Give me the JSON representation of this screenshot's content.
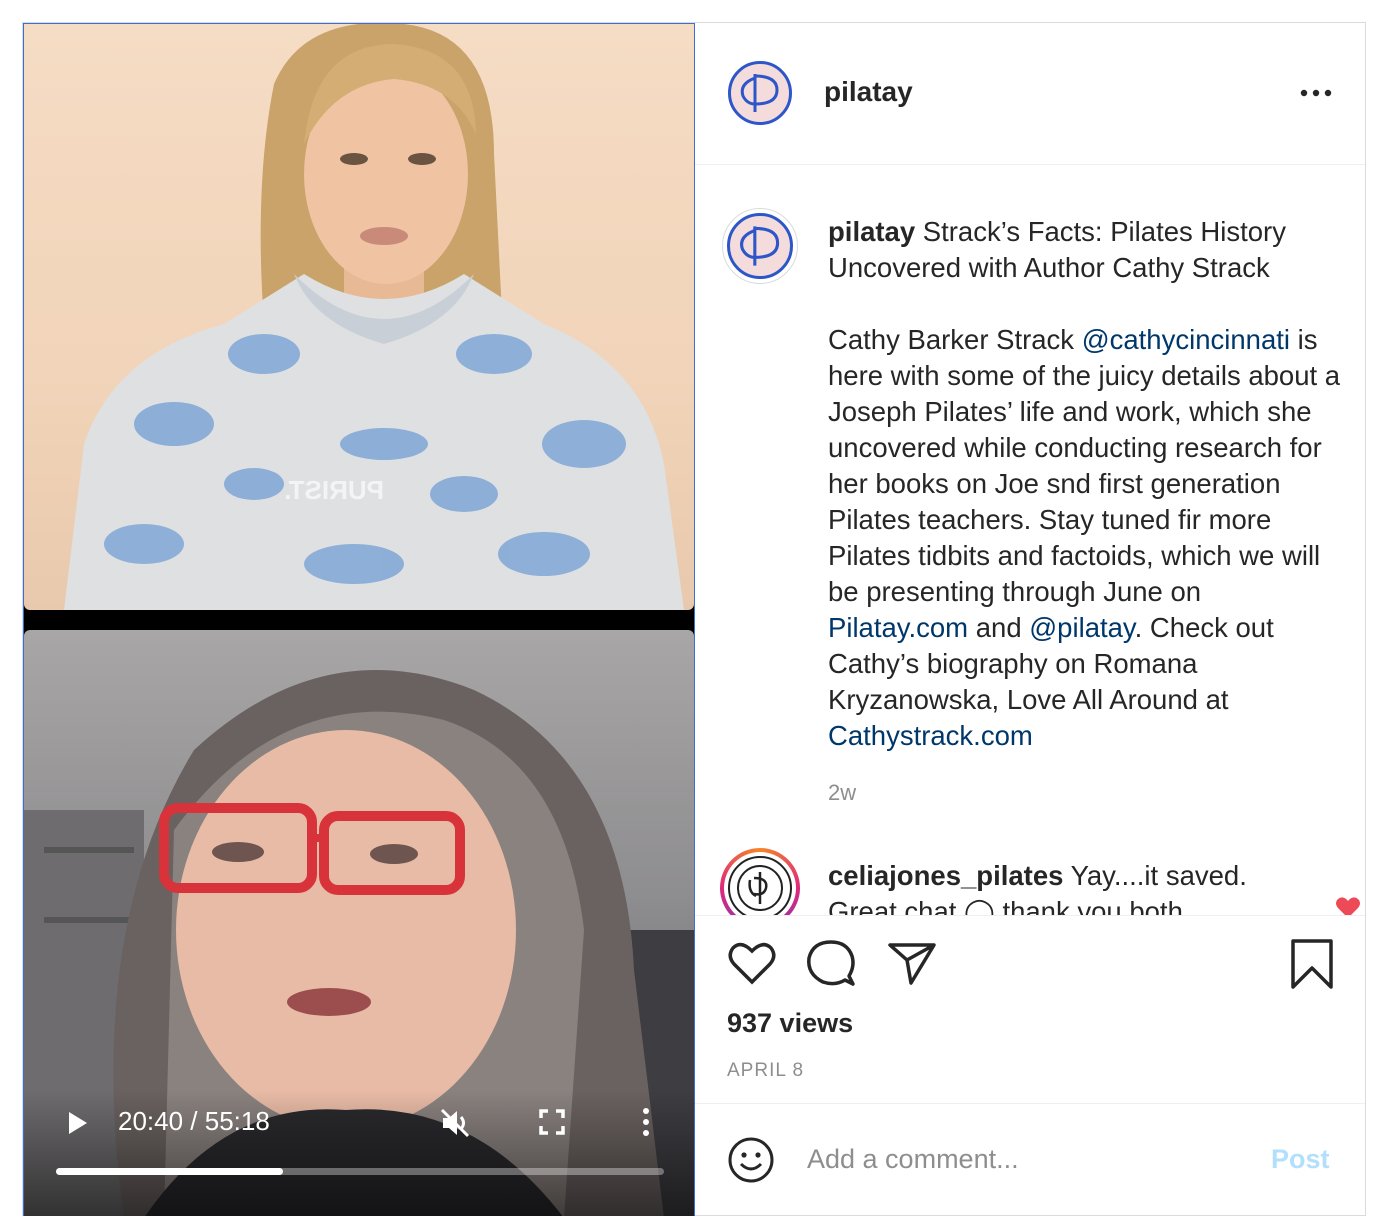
{
  "video": {
    "time_display": "20:40 / 55:18",
    "progress_fraction": 0.374,
    "shirt_text": "PURIST."
  },
  "header": {
    "username": "pilatay"
  },
  "caption": {
    "username": "pilatay",
    "title": "Strack’s Facts: Pilates History Uncovered with Author Cathy Strack",
    "body_1": "Cathy Barker Strack ",
    "mention_1": "@cathycincinnati",
    "body_2": " is here with some of the juicy details about a Joseph Pilates’ life and work, which she uncovered while conducting research for her books on Joe snd first generation Pilates teachers. Stay tuned fir more Pilates tidbits and factoids, which we will be presenting through June on ",
    "link_1": "Pilatay.com",
    "body_3": " and ",
    "mention_2": "@pilatay",
    "body_4": ". Check out Cathy’s biography on Romana Kryzanowska, Love All Around at ",
    "link_2": "Cathystrack.com",
    "age": "2w"
  },
  "comment": {
    "username": "celiajones_pilates",
    "text": "Yay....it saved. Great chat ◯ thank you both"
  },
  "stats": {
    "views": "937 views",
    "date": "APRIL 8"
  },
  "composer": {
    "placeholder": "Add a comment...",
    "post_label": "Post"
  },
  "colors": {
    "link": "#00376b",
    "like_red": "#ed4956",
    "post_disabled": "#b2dffc",
    "avatar_ring": "#2d56c9"
  },
  "icons": [
    "play-icon",
    "mute-icon",
    "fullscreen-icon",
    "more-vertical-icon",
    "more-horizontal-icon",
    "heart-icon",
    "comment-icon",
    "share-icon",
    "bookmark-icon",
    "emoji-icon"
  ]
}
